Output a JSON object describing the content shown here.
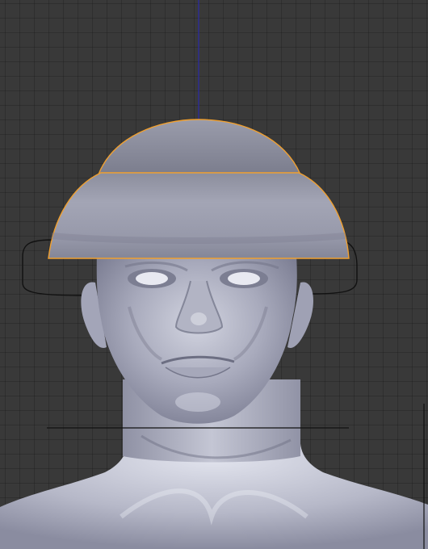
{
  "viewport": {
    "background_color": "#393939",
    "grid_line_color": "#2e2e2e",
    "z_axis_color": "#2a2aa8",
    "selection_outline_color": "#f0a030",
    "mesh_color": "#b4b6c8"
  },
  "scene": {
    "objects": [
      {
        "name": "head-mesh",
        "selected": false
      },
      {
        "name": "hat-brim-object",
        "selected": true
      },
      {
        "name": "hat-crown-object",
        "selected": true
      },
      {
        "name": "curve-object",
        "selected": false
      }
    ]
  }
}
